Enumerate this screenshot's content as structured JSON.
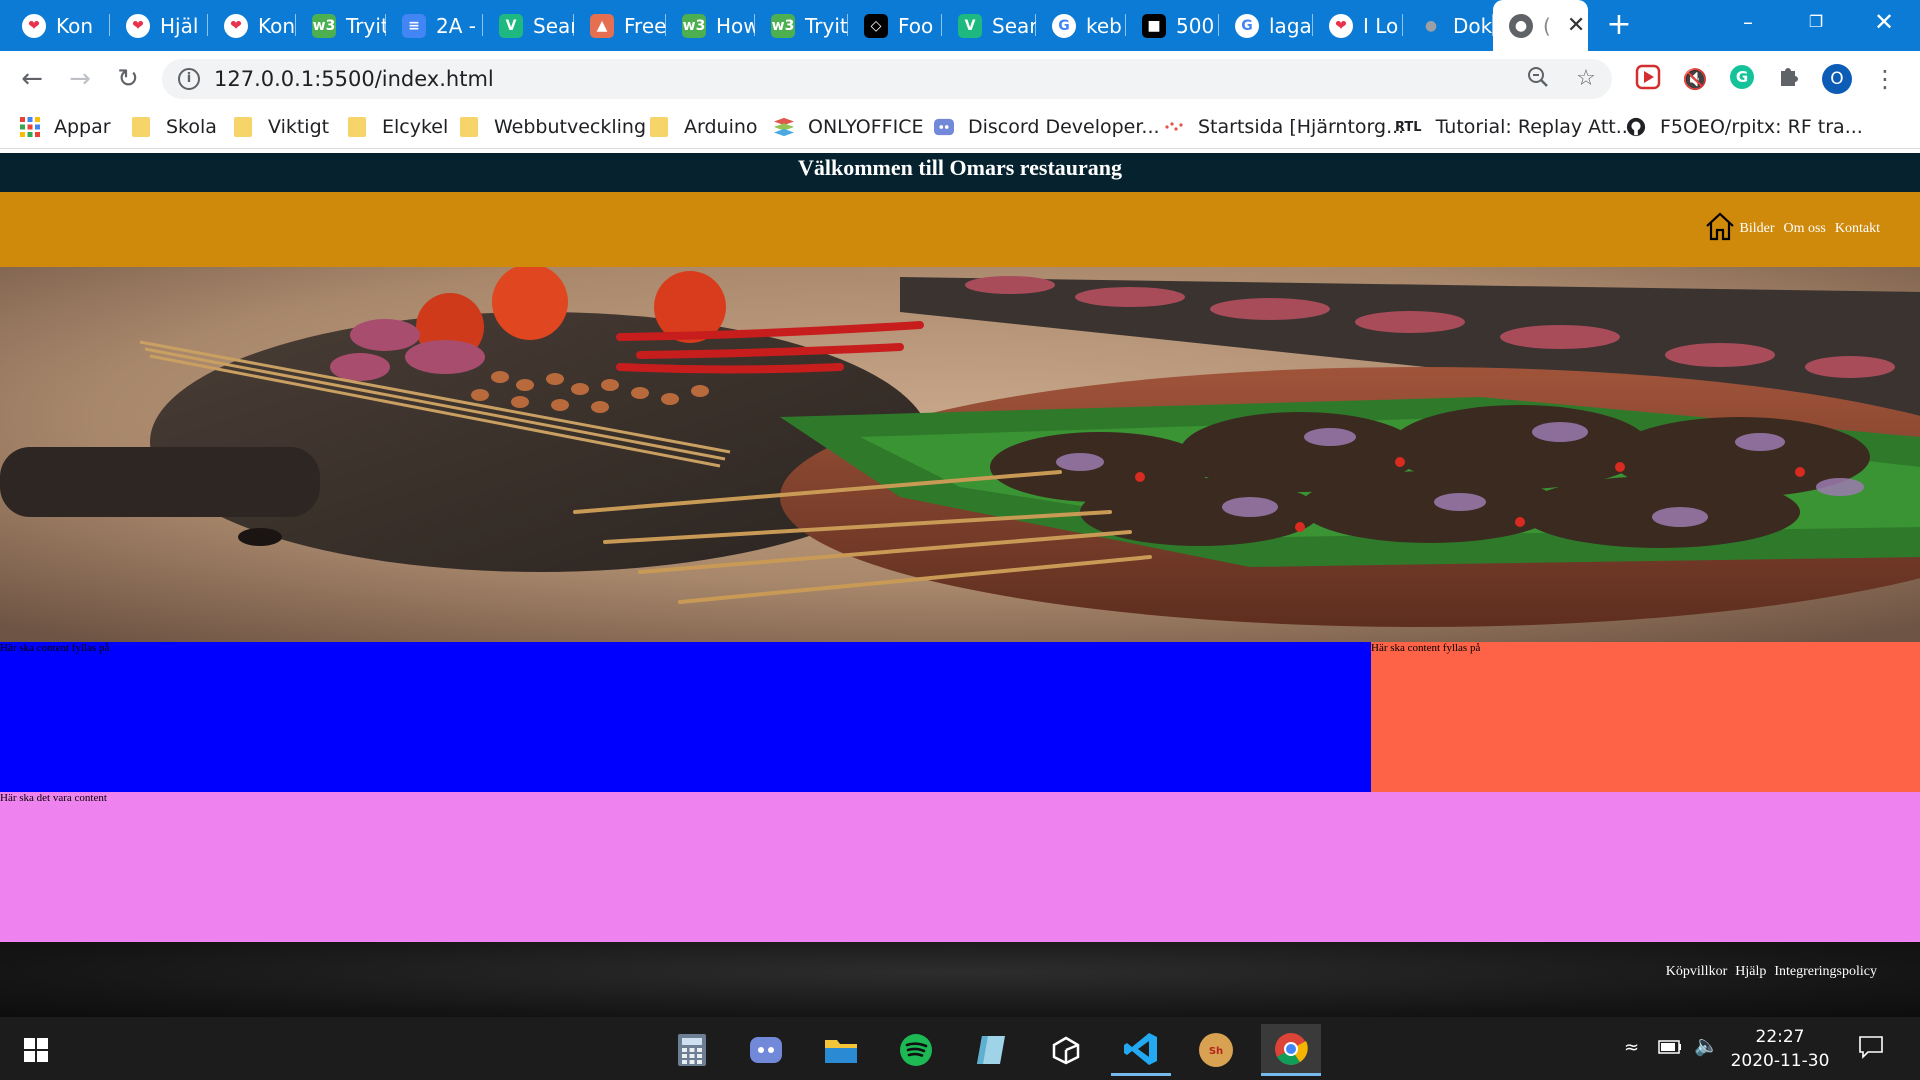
{
  "browser": {
    "tabs": [
      {
        "title": "Kon",
        "icon": "heart-icon",
        "color": "#e8334f"
      },
      {
        "title": "Hjäl",
        "icon": "heart-icon",
        "color": "#e8334f"
      },
      {
        "title": "Kon",
        "icon": "heart-icon",
        "color": "#e8334f"
      },
      {
        "title": "Tryit",
        "icon": "w3schools-icon",
        "color": "#4caf50"
      },
      {
        "title": "2A -",
        "icon": "docs-icon",
        "color": "#4285f4"
      },
      {
        "title": "Sear",
        "icon": "vuetify-icon",
        "color": "#1eb980"
      },
      {
        "title": "Free",
        "icon": "shapes-icon",
        "color": "#e76f51"
      },
      {
        "title": "How",
        "icon": "w3schools-icon",
        "color": "#4caf50"
      },
      {
        "title": "Tryit",
        "icon": "w3schools-icon",
        "color": "#4caf50"
      },
      {
        "title": "Foo",
        "icon": "codepen-icon",
        "color": "#000000"
      },
      {
        "title": "Sear",
        "icon": "vuetify-icon",
        "color": "#1eb980"
      },
      {
        "title": "keb",
        "icon": "google-icon",
        "color": "#ffffff"
      },
      {
        "title": "500",
        "icon": "unsplash-icon",
        "color": "#000000"
      },
      {
        "title": "laga",
        "icon": "google-icon",
        "color": "#ffffff"
      },
      {
        "title": "I Lo",
        "icon": "heart-icon",
        "color": "#e8334f"
      },
      {
        "title": "Dok",
        "icon": "globe-icon",
        "color": "#5f6368"
      },
      {
        "title": "(",
        "icon": "globe-icon",
        "color": "#5f6368"
      }
    ],
    "url": "127.0.0.1:5500/index.html",
    "profile_initial": "O",
    "bookmarks": [
      {
        "label": "Appar",
        "icon": "apps-grid-icon"
      },
      {
        "label": "Skola",
        "icon": "folder-icon"
      },
      {
        "label": "Viktigt",
        "icon": "folder-icon"
      },
      {
        "label": "Elcykel",
        "icon": "folder-icon"
      },
      {
        "label": "Webbutveckling",
        "icon": "folder-icon"
      },
      {
        "label": "Arduino",
        "icon": "folder-icon"
      },
      {
        "label": "ONLYOFFICE",
        "icon": "onlyoffice-icon"
      },
      {
        "label": "Discord Developer...",
        "icon": "discord-icon"
      },
      {
        "label": "Startsida [Hjärntorg...",
        "icon": "hjarntorget-icon"
      },
      {
        "label": "Tutorial: Replay Att...",
        "icon": "rtl-icon",
        "icon_text": "RTL"
      },
      {
        "label": "F5OEO/rpitx: RF tra...",
        "icon": "github-icon"
      }
    ]
  },
  "site": {
    "title": "Välkommen till Omars restaurang",
    "nav": [
      "Bilder",
      "Om oss",
      "Kontakt"
    ],
    "content_main": "Här ska content fyllas på",
    "content_side": "Här ska content fyllas på",
    "content_bottom": "Här ska det vara content",
    "footer_links": [
      "Köpvillkor",
      "Hjälp",
      "Integreringspolicy"
    ],
    "colors": {
      "header": "#05222e",
      "nav": "#cf8a0c",
      "main": "#0000ff",
      "side": "#ff6347",
      "bottom": "#ee82ee"
    }
  },
  "taskbar": {
    "apps": [
      "calculator-icon",
      "discord-icon",
      "file-explorer-icon",
      "spotify-icon",
      "notes-icon",
      "unity-icon",
      "vscode-icon",
      "shotcut-icon",
      "chrome-icon"
    ],
    "time": "22:27",
    "date": "2020-11-30"
  }
}
